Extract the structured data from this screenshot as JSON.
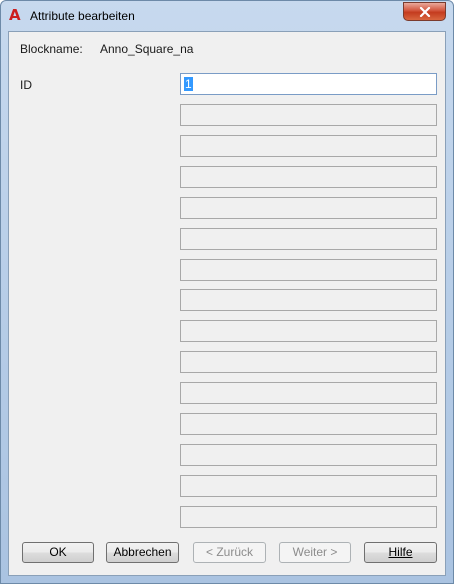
{
  "window": {
    "title": "Attribute bearbeiten",
    "icon": "autocad-a-icon",
    "close_glyph": "✕"
  },
  "block": {
    "label": "Blockname:",
    "value": "Anno_Square_na"
  },
  "attributes": [
    {
      "label": "ID",
      "value": "1"
    }
  ],
  "empty_fields": 14,
  "buttons": {
    "ok": "OK",
    "cancel": "Abbrechen",
    "back": "< Zurück",
    "next": "Weiter >",
    "help": "Hilfe"
  }
}
